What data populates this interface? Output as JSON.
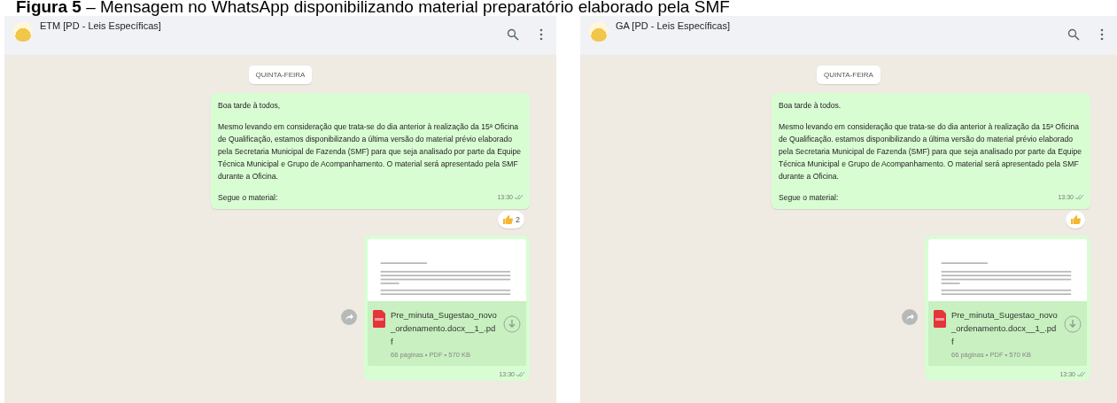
{
  "caption": "**Figura 5** – Mensagem no WhatsApp disponibilizando material preparatório elaborado pela SMF",
  "chats": [
    {
      "title": "ETM [PD - Leis Específicas]",
      "date_chip": "QUINTA-FEIRA",
      "message": {
        "paragraphs": [
          "Boa tarde à todos,",
          "Mesmo levando em consideração que trata-se do dia anterior à realização da 15ª Oficina de Qualificação, estamos disponibilizando a última versão do material prévio elaborado pela Secretaria Municipal de Fazenda (SMF) para que seja analisado por parte da Equipe Técnica Municipal e Grupo de Acompanhamento. O material será apresentado pela SMF durante a Oficina.",
          "Segue o material:"
        ],
        "time": "13:30",
        "reaction_count": "2"
      },
      "file": {
        "name": "Pre_minuta_Sugestao_novo_ordenamento.docx__1_.pdf",
        "meta": "66 páginas • PDF • 570 KB",
        "time": "13:30"
      }
    },
    {
      "title": "GA [PD - Leis Específicas]",
      "date_chip": "QUINTA-FEIRA",
      "message": {
        "paragraphs": [
          "Boa tarde à todos.",
          "Mesmo levando em consideração que trata-se do dia anterior à realização da 15ª Oficina de Qualificação. estamos disponibilizando a última versão do material prévio elaborado pela Secretaria Municipal de Fazenda (SMF) para que seja analisado por parte da Equipe Técnica Municipal e Grupo de Acompanhamento. O material será apresentado pela SMF durante a Oficina.",
          "Segue o material:"
        ],
        "time": "13:30"
      },
      "file": {
        "name": "Pre_minuta_Sugestao_novo_ordenamento.docx__1_.pdf",
        "meta": "66 páginas • PDF • 570 KB",
        "time": "13:30"
      }
    }
  ]
}
